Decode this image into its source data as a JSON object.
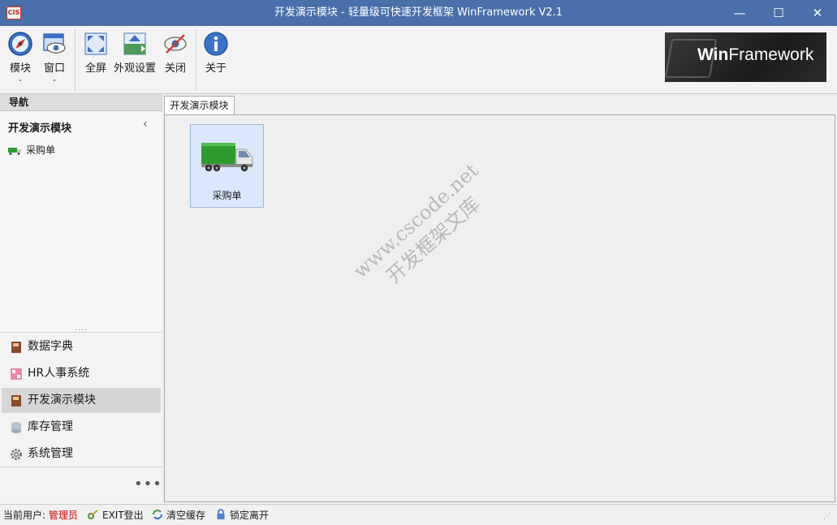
{
  "window": {
    "icon_text": "CIS",
    "title": "开发演示模块 - 轻量级可快速开发框架 WinFramework V2.1",
    "minimize": "—",
    "maximize": "☐",
    "close": "✕"
  },
  "ribbon": {
    "buttons": [
      {
        "label": "模块",
        "icon": "compass-icon",
        "dropdown": true
      },
      {
        "label": "窗口",
        "icon": "window-eye-icon",
        "dropdown": true
      },
      {
        "label": "全屏",
        "icon": "fullscreen-icon"
      },
      {
        "label": "外观设置",
        "icon": "appearance-icon"
      },
      {
        "label": "关闭",
        "icon": "close-eye-icon"
      },
      {
        "label": "关于",
        "icon": "info-icon"
      }
    ],
    "caret": "⌄",
    "logo": {
      "part1": "Win",
      "part2": "Framework"
    }
  },
  "nav": {
    "header": "导航",
    "group_title": "开发演示模块",
    "collapse": "‹",
    "items": [
      {
        "label": "采购单",
        "icon": "truck-icon"
      }
    ],
    "grip": "....",
    "list": [
      {
        "label": "数据字典",
        "icon": "book-icon",
        "selected": false
      },
      {
        "label": "HR人事系统",
        "icon": "hr-icon",
        "selected": false
      },
      {
        "label": "开发演示模块",
        "icon": "book-icon",
        "selected": true
      },
      {
        "label": "库存管理",
        "icon": "database-icon",
        "selected": false
      },
      {
        "label": "系统管理",
        "icon": "gear-icon",
        "selected": false
      }
    ],
    "more": "•••"
  },
  "content": {
    "tab": "开发演示模块",
    "tiles": [
      {
        "label": "采购单",
        "icon": "truck-icon"
      }
    ],
    "watermark_line1": "www.cscode.net",
    "watermark_line2": "开发框架文库"
  },
  "status": {
    "user_label": "当前用户:",
    "user_name": "管理员",
    "exit": "EXIT登出",
    "clear_cache": "清空缓存",
    "lock": "锁定离开",
    "grip": "⋰"
  },
  "colors": {
    "titlebar": "#4a6faa",
    "tile_bg": "#dbe8fb",
    "user_name": "#d10000"
  }
}
